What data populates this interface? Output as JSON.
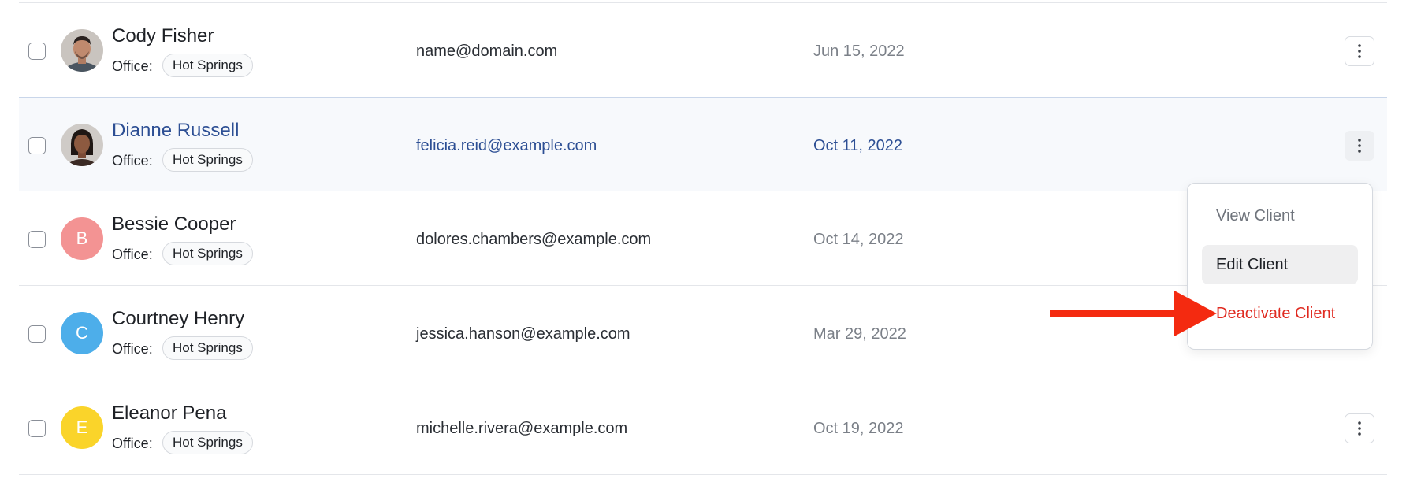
{
  "office_label": "Office:",
  "clients": [
    {
      "name": "Cody Fisher",
      "office": "Hot Springs",
      "email": "name@domain.com",
      "date": "Jun 15, 2022",
      "avatar": {
        "type": "photo",
        "name": "man-portrait"
      }
    },
    {
      "name": "Dianne Russell",
      "office": "Hot Springs",
      "email": "felicia.reid@example.com",
      "date": "Oct 11, 2022",
      "avatar": {
        "type": "photo",
        "name": "woman-portrait"
      },
      "highlighted": true
    },
    {
      "name": "Bessie Cooper",
      "office": "Hot Springs",
      "email": "dolores.chambers@example.com",
      "date": "Oct 14, 2022",
      "avatar": {
        "type": "initial",
        "initial": "B",
        "color": "#f39393"
      }
    },
    {
      "name": "Courtney Henry",
      "office": "Hot Springs",
      "email": "jessica.hanson@example.com",
      "date": "Mar 29, 2022",
      "avatar": {
        "type": "initial",
        "initial": "C",
        "color": "#4daeea"
      }
    },
    {
      "name": "Eleanor Pena",
      "office": "Hot Springs",
      "email": "michelle.rivera@example.com",
      "date": "Oct 19, 2022",
      "avatar": {
        "type": "initial",
        "initial": "E",
        "color": "#fad42a"
      }
    }
  ],
  "dropdown": {
    "items": [
      {
        "label": "View Client"
      },
      {
        "label": "Edit Client",
        "hovered": true
      },
      {
        "label": "Deactivate Client",
        "destructive": true
      }
    ]
  },
  "colors": {
    "accent": "#2d4f94",
    "destructive": "#e02a20",
    "annotation_arrow": "#f42a10"
  },
  "annotation": {
    "icon": "red-arrow-icon"
  }
}
